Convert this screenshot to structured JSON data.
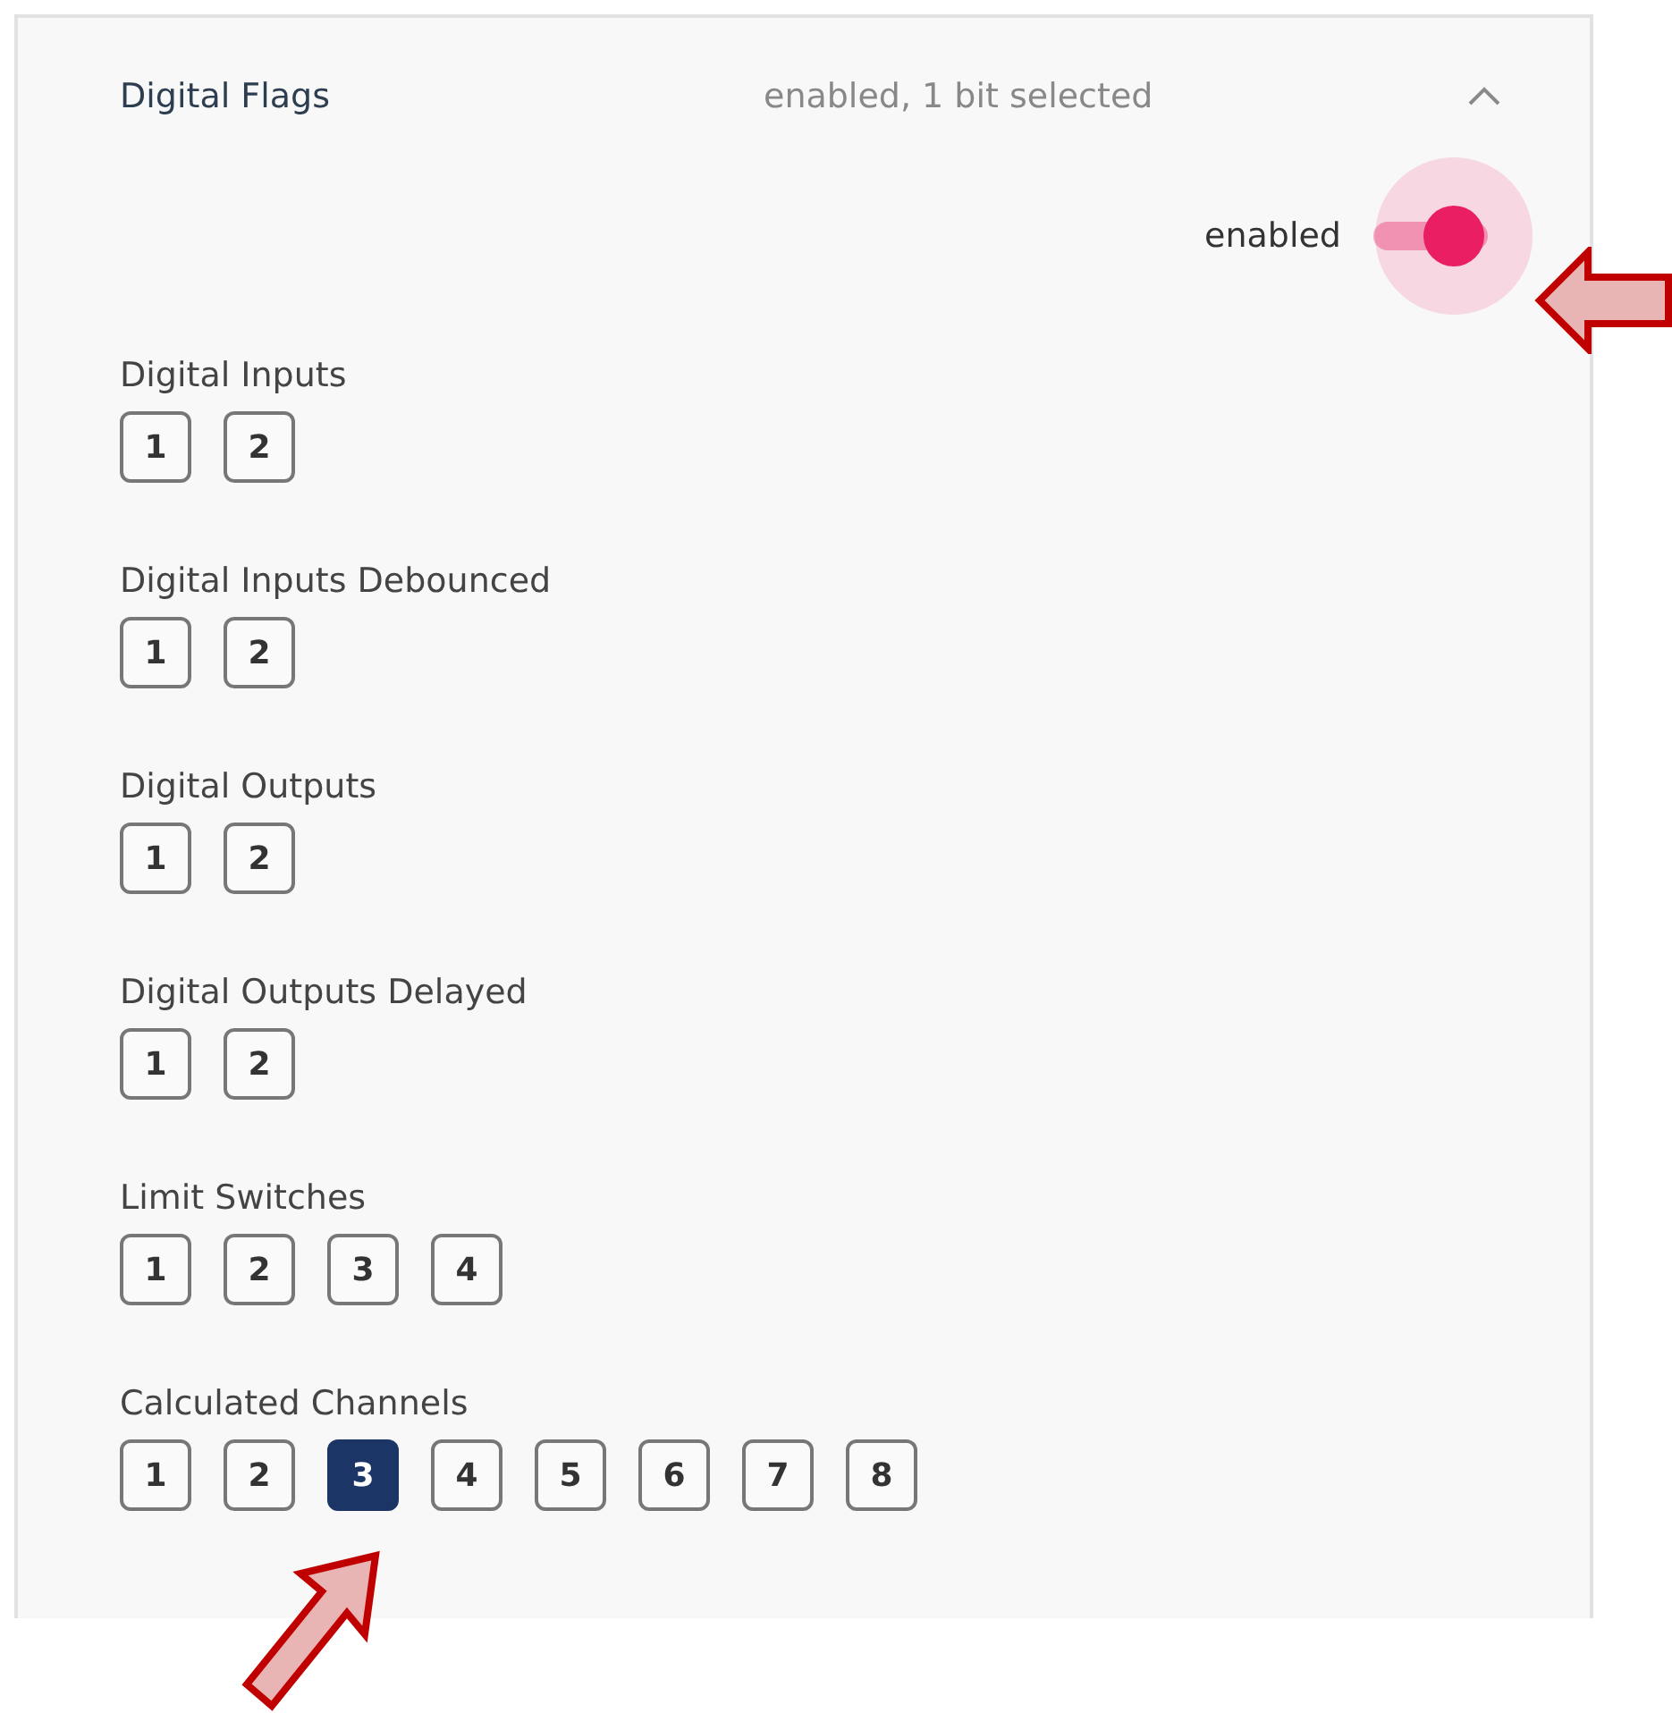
{
  "panel": {
    "title": "Digital Flags",
    "summary": "enabled, 1 bit selected",
    "expanded": true
  },
  "toggle": {
    "label": "enabled",
    "on": true
  },
  "groups": [
    {
      "label": "Digital Inputs",
      "bits": [
        {
          "label": "1",
          "selected": false
        },
        {
          "label": "2",
          "selected": false
        }
      ]
    },
    {
      "label": "Digital Inputs Debounced",
      "bits": [
        {
          "label": "1",
          "selected": false
        },
        {
          "label": "2",
          "selected": false
        }
      ]
    },
    {
      "label": "Digital Outputs",
      "bits": [
        {
          "label": "1",
          "selected": false
        },
        {
          "label": "2",
          "selected": false
        }
      ]
    },
    {
      "label": "Digital Outputs Delayed",
      "bits": [
        {
          "label": "1",
          "selected": false
        },
        {
          "label": "2",
          "selected": false
        }
      ]
    },
    {
      "label": "Limit Switches",
      "bits": [
        {
          "label": "1",
          "selected": false
        },
        {
          "label": "2",
          "selected": false
        },
        {
          "label": "3",
          "selected": false
        },
        {
          "label": "4",
          "selected": false
        }
      ]
    },
    {
      "label": "Calculated Channels",
      "bits": [
        {
          "label": "1",
          "selected": false
        },
        {
          "label": "2",
          "selected": false
        },
        {
          "label": "3",
          "selected": true
        },
        {
          "label": "4",
          "selected": false
        },
        {
          "label": "5",
          "selected": false
        },
        {
          "label": "6",
          "selected": false
        },
        {
          "label": "7",
          "selected": false
        },
        {
          "label": "8",
          "selected": false
        }
      ]
    }
  ]
}
